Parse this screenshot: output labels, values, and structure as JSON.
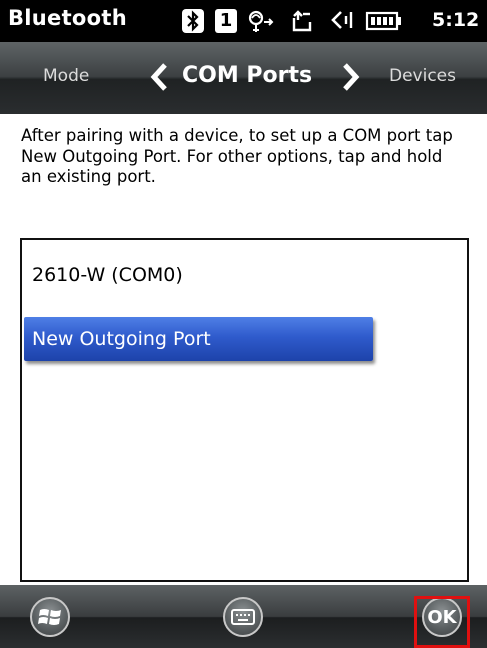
{
  "status_bar": {
    "title": "Bluetooth",
    "sim_slot": "1",
    "time": "5:12",
    "icons": [
      "bluetooth-icon",
      "sim-icon",
      "wifi-icon",
      "sync-icon",
      "volume-icon",
      "battery-icon"
    ]
  },
  "tabs": {
    "prev": "Mode",
    "current": "COM Ports",
    "next": "Devices"
  },
  "description": "After pairing with a device, to set up a COM port tap New Outgoing Port. For other options, tap and hold an existing port.",
  "ports": {
    "items": [
      {
        "label": "2610-W (COM0)",
        "selected": false
      },
      {
        "label": "New Outgoing Port",
        "selected": true
      }
    ]
  },
  "bottom_bar": {
    "ok_label": "OK",
    "icons": [
      "windows-start-icon",
      "keyboard-icon",
      "ok-icon"
    ],
    "highlight_color": "#e01010"
  }
}
